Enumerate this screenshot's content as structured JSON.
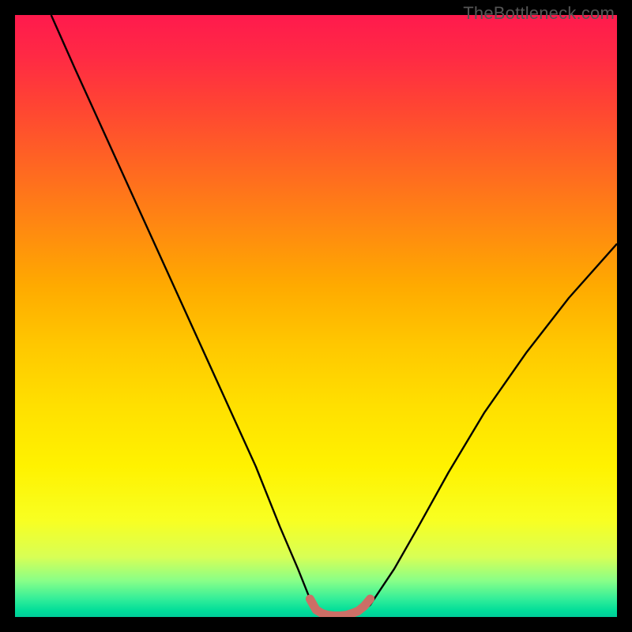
{
  "watermark": "TheBottleneck.com",
  "chart_data": {
    "type": "line",
    "title": "",
    "xlabel": "",
    "ylabel": "",
    "xlim": [
      0,
      100
    ],
    "ylim": [
      0,
      100
    ],
    "series": [
      {
        "name": "bottleneck-curve",
        "x": [
          6,
          10,
          15,
          20,
          25,
          30,
          35,
          40,
          44,
          47,
          49,
          51,
          53,
          55,
          57,
          59,
          60,
          63,
          67,
          72,
          78,
          85,
          92,
          100
        ],
        "values": [
          100,
          91,
          80,
          69,
          58,
          47,
          36,
          25,
          15,
          8,
          3,
          0.5,
          0.2,
          0.2,
          0.5,
          2,
          3.5,
          8,
          15,
          24,
          34,
          44,
          53,
          62
        ]
      },
      {
        "name": "optimal-band",
        "x": [
          49,
          50,
          51,
          52,
          53,
          54,
          55,
          56,
          57,
          58,
          59
        ],
        "values": [
          3,
          1.2,
          0.6,
          0.3,
          0.2,
          0.2,
          0.3,
          0.6,
          1,
          1.8,
          3
        ]
      }
    ],
    "styles": {
      "bottleneck-curve": {
        "stroke": "#000000",
        "stroke_width": 2.4,
        "fill": "none"
      },
      "optimal-band": {
        "stroke": "#cc6e66",
        "stroke_width": 11,
        "fill": "none",
        "linecap": "round"
      }
    },
    "grid": false,
    "legend": false
  }
}
